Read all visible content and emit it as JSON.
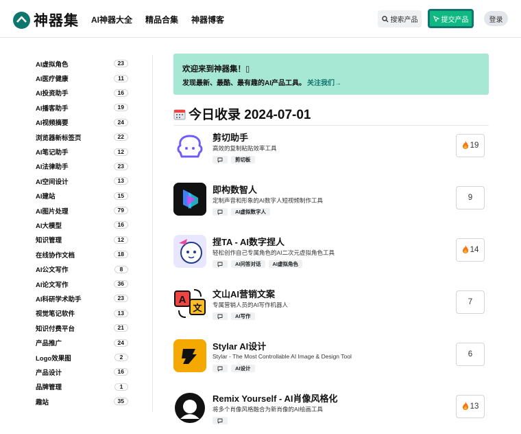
{
  "header": {
    "logo_text": "神器集",
    "nav": [
      "AI神器大全",
      "精品合集",
      "神器博客"
    ],
    "search_label": "搜索产品",
    "submit_label": "提交产品",
    "login_label": "登录"
  },
  "sidebar": {
    "items": [
      {
        "label": "AI虚拟角色",
        "count": "23"
      },
      {
        "label": "AI医疗健康",
        "count": "11"
      },
      {
        "label": "AI投资助手",
        "count": "16"
      },
      {
        "label": "AI播客助手",
        "count": "19"
      },
      {
        "label": "AI视频摘要",
        "count": "24"
      },
      {
        "label": "浏览器新标签页",
        "count": "22"
      },
      {
        "label": "AI笔记助手",
        "count": "12"
      },
      {
        "label": "AI法律助手",
        "count": "23"
      },
      {
        "label": "AI空间设计",
        "count": "13"
      },
      {
        "label": "AI建站",
        "count": "15"
      },
      {
        "label": "AI图片处理",
        "count": "79"
      },
      {
        "label": "AI大模型",
        "count": "16"
      },
      {
        "label": "知识管理",
        "count": "12"
      },
      {
        "label": "在线协作文档",
        "count": "18"
      },
      {
        "label": "AI公文写作",
        "count": "8"
      },
      {
        "label": "AI论文写作",
        "count": "36"
      },
      {
        "label": "AI科研学术助手",
        "count": "23"
      },
      {
        "label": "视觉笔记软件",
        "count": "13"
      },
      {
        "label": "知识付费平台",
        "count": "21"
      },
      {
        "label": "产品推广",
        "count": "24"
      },
      {
        "label": "Logo效果图",
        "count": "2"
      },
      {
        "label": "产品设计",
        "count": "16"
      },
      {
        "label": "品牌管理",
        "count": "1"
      },
      {
        "label": "趣站",
        "count": "35"
      }
    ]
  },
  "welcome": {
    "title": "欢迎来到神器集！▯",
    "subtitle": "发现最新、最酷、最有趣的AI产品工具。",
    "follow_link": "关注我们→"
  },
  "section": {
    "calendar_icon": "calendar-icon",
    "title": "今日收录 2024-07-01"
  },
  "products": [
    {
      "name": "剪切助手",
      "desc": "高效的复制粘贴效率工具",
      "tags": [
        "剪切板"
      ],
      "votes": "19",
      "hot": true,
      "thumb_bg": "#ffffff"
    },
    {
      "name": "即构数智人",
      "desc": "定制声音和形象的AI数字人短视频制作工具",
      "tags": [
        "AI虚拟数字人"
      ],
      "votes": "9",
      "hot": false,
      "thumb_bg": "#111111"
    },
    {
      "name": "捏TA - AI数字捏人",
      "desc": "轻松创作自己专属角色的AI二次元虚拟角色工具",
      "tags": [
        "AI问答对话",
        "AI虚拟角色"
      ],
      "votes": "14",
      "hot": true,
      "thumb_bg": "#e9e6ff"
    },
    {
      "name": "文山AI营销文案",
      "desc": "专属营销人员的AI写作机器人",
      "tags": [
        "AI写作"
      ],
      "votes": "7",
      "hot": false,
      "thumb_bg": "#ffffff"
    },
    {
      "name": "Stylar AI设计",
      "desc": "Stylar - The Most Controllable AI Image & Design Tool",
      "tags": [
        "AI设计"
      ],
      "votes": "6",
      "hot": false,
      "thumb_bg": "#f5a800"
    },
    {
      "name": "Remix Yourself - AI肖像风格化",
      "desc": "将多个肖像风格融合为新肖像的AI绘画工具",
      "tags": [],
      "votes": "13",
      "hot": true,
      "thumb_bg": "#ffffff"
    }
  ],
  "colors": {
    "accent": "#10b981",
    "accent_dark": "#0f766e",
    "welcome_bg": "#a7e8d4",
    "hot": "#f97316"
  }
}
